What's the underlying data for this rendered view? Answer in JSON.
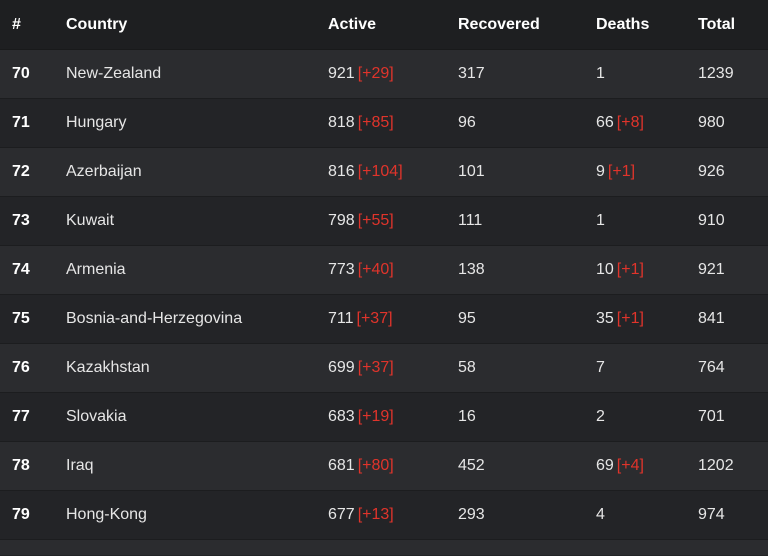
{
  "header": {
    "num": "#",
    "country": "Country",
    "active": "Active",
    "recovered": "Recovered",
    "deaths": "Deaths",
    "total": "Total"
  },
  "rows": [
    {
      "num": "70",
      "country": "New-Zealand",
      "active": "921",
      "active_delta": "[+29]",
      "recovered": "317",
      "deaths": "1",
      "deaths_delta": "",
      "total": "1239"
    },
    {
      "num": "71",
      "country": "Hungary",
      "active": "818",
      "active_delta": "[+85]",
      "recovered": "96",
      "deaths": "66",
      "deaths_delta": "[+8]",
      "total": "980"
    },
    {
      "num": "72",
      "country": "Azerbaijan",
      "active": "816",
      "active_delta": "[+104]",
      "recovered": "101",
      "deaths": "9",
      "deaths_delta": "[+1]",
      "total": "926"
    },
    {
      "num": "73",
      "country": "Kuwait",
      "active": "798",
      "active_delta": "[+55]",
      "recovered": "111",
      "deaths": "1",
      "deaths_delta": "",
      "total": "910"
    },
    {
      "num": "74",
      "country": "Armenia",
      "active": "773",
      "active_delta": "[+40]",
      "recovered": "138",
      "deaths": "10",
      "deaths_delta": "[+1]",
      "total": "921"
    },
    {
      "num": "75",
      "country": "Bosnia-and-Herzegovina",
      "active": "711",
      "active_delta": "[+37]",
      "recovered": "95",
      "deaths": "35",
      "deaths_delta": "[+1]",
      "total": "841"
    },
    {
      "num": "76",
      "country": "Kazakhstan",
      "active": "699",
      "active_delta": "[+37]",
      "recovered": "58",
      "deaths": "7",
      "deaths_delta": "",
      "total": "764"
    },
    {
      "num": "77",
      "country": "Slovakia",
      "active": "683",
      "active_delta": "[+19]",
      "recovered": "16",
      "deaths": "2",
      "deaths_delta": "",
      "total": "701"
    },
    {
      "num": "78",
      "country": "Iraq",
      "active": "681",
      "active_delta": "[+80]",
      "recovered": "452",
      "deaths": "69",
      "deaths_delta": "[+4]",
      "total": "1202"
    },
    {
      "num": "79",
      "country": "Hong-Kong",
      "active": "677",
      "active_delta": "[+13]",
      "recovered": "293",
      "deaths": "4",
      "deaths_delta": "",
      "total": "974"
    }
  ],
  "colors": {
    "delta": "#e0342b",
    "row_odd": "#2b2c2f",
    "row_even": "#232427",
    "header_bg": "#1e1f21"
  }
}
